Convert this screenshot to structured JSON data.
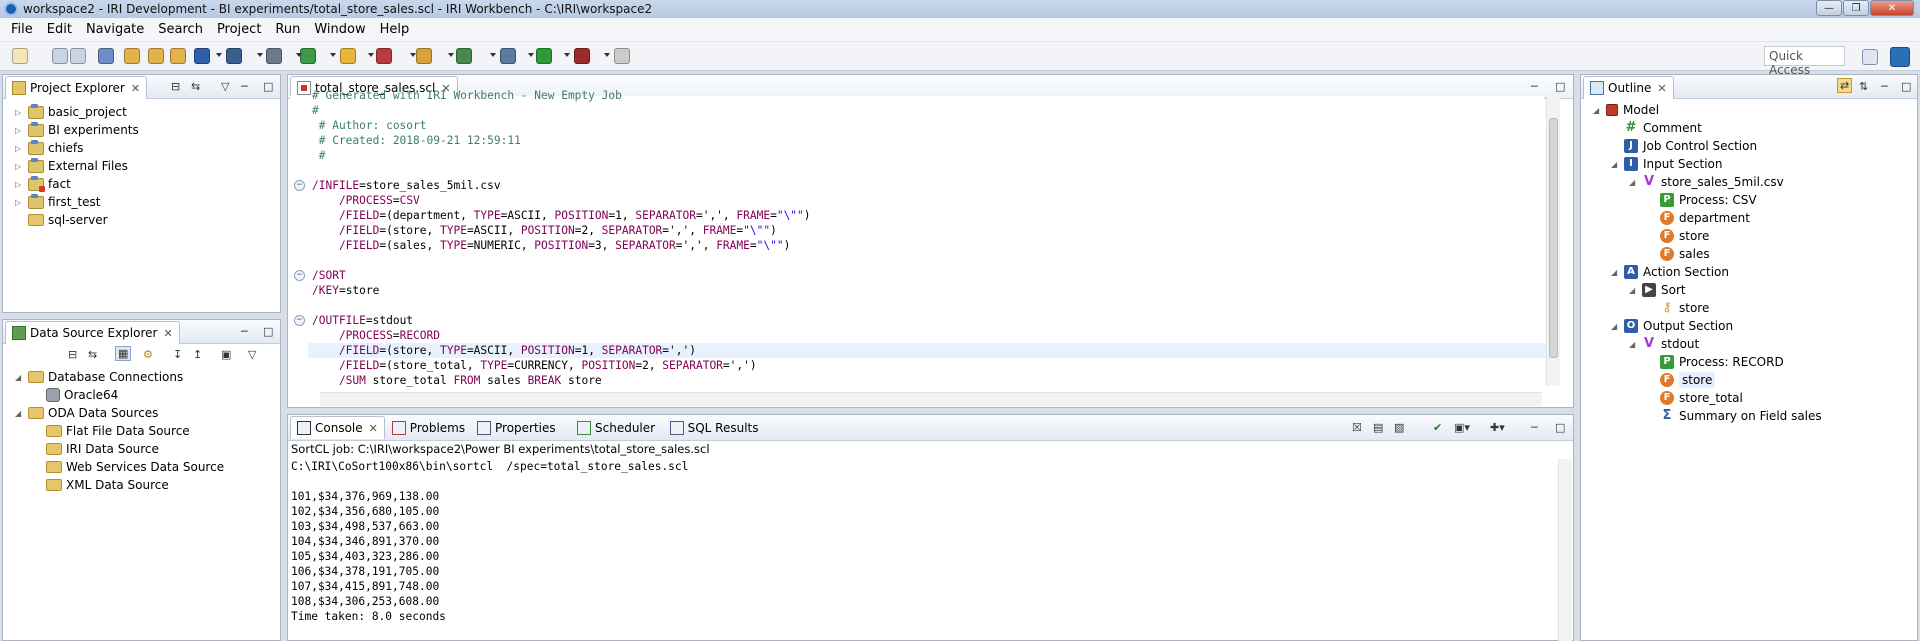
{
  "window": {
    "title": "workspace2 - IRI Development - BI experiments/total_store_sales.scl - IRI Workbench - C:\\IRI\\workspace2"
  },
  "menu": [
    "File",
    "Edit",
    "Navigate",
    "Search",
    "Project",
    "Run",
    "Window",
    "Help"
  ],
  "toolbar": {
    "quick_access": "Quick Access"
  },
  "project_explorer": {
    "tab_label": "Project Explorer",
    "items": [
      {
        "label": "basic_project",
        "kind": "project"
      },
      {
        "label": "BI experiments",
        "kind": "project"
      },
      {
        "label": "chiefs",
        "kind": "project"
      },
      {
        "label": "External Files",
        "kind": "project"
      },
      {
        "label": "fact",
        "kind": "project-error"
      },
      {
        "label": "first_test",
        "kind": "project"
      },
      {
        "label": "sql-server",
        "kind": "folder"
      }
    ]
  },
  "data_source_explorer": {
    "tab_label": "Data Source Explorer",
    "items": [
      {
        "label": "Database Connections",
        "level": 0
      },
      {
        "label": "Oracle64",
        "level": 1
      },
      {
        "label": "ODA Data Sources",
        "level": 0
      },
      {
        "label": "Flat File Data Source",
        "level": 1
      },
      {
        "label": "IRI Data Source",
        "level": 1
      },
      {
        "label": "Web Services Data Source",
        "level": 1
      },
      {
        "label": "XML Data Source",
        "level": 1
      }
    ]
  },
  "editor": {
    "tab_label": "total_store_sales.scl",
    "lines": [
      {
        "parts": [
          {
            "t": "# Generated with IRI Workbench - New Empty Job",
            "c": "cmt"
          }
        ]
      },
      {
        "parts": [
          {
            "t": "#",
            "c": "cmt"
          }
        ]
      },
      {
        "parts": [
          {
            "t": " # Author: cosort",
            "c": "cmt"
          }
        ]
      },
      {
        "parts": [
          {
            "t": " # Created: 2018-09-21 12:59:11",
            "c": "cmt"
          }
        ]
      },
      {
        "parts": [
          {
            "t": " #",
            "c": "cmt"
          }
        ]
      },
      {
        "parts": []
      },
      {
        "parts": [
          {
            "t": "/INFILE",
            "c": "kw"
          },
          {
            "t": "=store_sales_5mil.csv",
            "c": ""
          }
        ],
        "fold": true
      },
      {
        "parts": [
          {
            "t": "    /PROCESS",
            "c": "kw"
          },
          {
            "t": "=",
            "c": ""
          },
          {
            "t": "CSV",
            "c": "kw"
          }
        ]
      },
      {
        "parts": [
          {
            "t": "    /FIELD",
            "c": "kw"
          },
          {
            "t": "=(department, ",
            "c": ""
          },
          {
            "t": "TYPE",
            "c": "kw"
          },
          {
            "t": "=ASCII, ",
            "c": ""
          },
          {
            "t": "POSITION",
            "c": "kw"
          },
          {
            "t": "=1, ",
            "c": ""
          },
          {
            "t": "SEPARATOR",
            "c": "kw"
          },
          {
            "t": "=',', ",
            "c": ""
          },
          {
            "t": "FRAME",
            "c": "kw"
          },
          {
            "t": "=",
            "c": ""
          },
          {
            "t": "\"\\\"\"",
            "c": "str"
          },
          {
            "t": ")",
            "c": ""
          }
        ]
      },
      {
        "parts": [
          {
            "t": "    /FIELD",
            "c": "kw"
          },
          {
            "t": "=(store, ",
            "c": ""
          },
          {
            "t": "TYPE",
            "c": "kw"
          },
          {
            "t": "=ASCII, ",
            "c": ""
          },
          {
            "t": "POSITION",
            "c": "kw"
          },
          {
            "t": "=2, ",
            "c": ""
          },
          {
            "t": "SEPARATOR",
            "c": "kw"
          },
          {
            "t": "=',', ",
            "c": ""
          },
          {
            "t": "FRAME",
            "c": "kw"
          },
          {
            "t": "=",
            "c": ""
          },
          {
            "t": "\"\\\"\"",
            "c": "str"
          },
          {
            "t": ")",
            "c": ""
          }
        ]
      },
      {
        "parts": [
          {
            "t": "    /FIELD",
            "c": "kw"
          },
          {
            "t": "=(sales, ",
            "c": ""
          },
          {
            "t": "TYPE",
            "c": "kw"
          },
          {
            "t": "=NUMERIC, ",
            "c": ""
          },
          {
            "t": "POSITION",
            "c": "kw"
          },
          {
            "t": "=3, ",
            "c": ""
          },
          {
            "t": "SEPARATOR",
            "c": "kw"
          },
          {
            "t": "=',', ",
            "c": ""
          },
          {
            "t": "FRAME",
            "c": "kw"
          },
          {
            "t": "=",
            "c": ""
          },
          {
            "t": "\"\\\"\"",
            "c": "str"
          },
          {
            "t": ")",
            "c": ""
          }
        ]
      },
      {
        "parts": []
      },
      {
        "parts": [
          {
            "t": "/SORT",
            "c": "kw"
          }
        ],
        "fold": true
      },
      {
        "parts": [
          {
            "t": "/KEY",
            "c": "kw"
          },
          {
            "t": "=store",
            "c": ""
          }
        ]
      },
      {
        "parts": []
      },
      {
        "parts": [
          {
            "t": "/OUTFILE",
            "c": "kw"
          },
          {
            "t": "=stdout",
            "c": ""
          }
        ],
        "fold": true
      },
      {
        "parts": [
          {
            "t": "    /PROCESS",
            "c": "kw"
          },
          {
            "t": "=",
            "c": ""
          },
          {
            "t": "RECORD",
            "c": "kw"
          }
        ]
      },
      {
        "parts": [
          {
            "t": "    /FIELD",
            "c": "kw"
          },
          {
            "t": "=(store, ",
            "c": ""
          },
          {
            "t": "TYPE",
            "c": "kw"
          },
          {
            "t": "=ASCII, ",
            "c": ""
          },
          {
            "t": "POSITION",
            "c": "kw"
          },
          {
            "t": "=1, ",
            "c": ""
          },
          {
            "t": "SEPARATOR",
            "c": "kw"
          },
          {
            "t": "=',')",
            "c": ""
          }
        ],
        "highlight": true
      },
      {
        "parts": [
          {
            "t": "    /FIELD",
            "c": "kw"
          },
          {
            "t": "=(store_total, ",
            "c": ""
          },
          {
            "t": "TYPE",
            "c": "kw"
          },
          {
            "t": "=CURRENCY, ",
            "c": ""
          },
          {
            "t": "POSITION",
            "c": "kw"
          },
          {
            "t": "=2, ",
            "c": ""
          },
          {
            "t": "SEPARATOR",
            "c": "kw"
          },
          {
            "t": "=',')",
            "c": ""
          }
        ]
      },
      {
        "parts": [
          {
            "t": "    /SUM",
            "c": "kw"
          },
          {
            "t": " store_total ",
            "c": ""
          },
          {
            "t": "FROM",
            "c": "kw"
          },
          {
            "t": " sales ",
            "c": ""
          },
          {
            "t": "BREAK",
            "c": "kw"
          },
          {
            "t": " store",
            "c": ""
          }
        ]
      }
    ]
  },
  "bottom_tabs": [
    "Console",
    "Problems",
    "Properties",
    "Scheduler",
    "SQL Results"
  ],
  "console": {
    "job_line": "SortCL job: C:\\IRI\\workspace2\\Power BI experiments\\total_store_sales.scl",
    "lines": [
      "C:\\IRI\\CoSort100x86\\bin\\sortcl  /spec=total_store_sales.scl",
      "",
      "101,$34,376,969,138.00",
      "102,$34,356,680,105.00",
      "103,$34,498,537,663.00",
      "104,$34,346,891,370.00",
      "105,$34,403,323,286.00",
      "106,$34,378,191,705.00",
      "107,$34,415,891,748.00",
      "108,$34,306,253,608.00",
      "Time taken: 8.0 seconds"
    ]
  },
  "outline": {
    "tab_label": "Outline",
    "items": [
      {
        "label": "Model",
        "icon": "model",
        "level": 0
      },
      {
        "label": "Comment",
        "icon": "hash",
        "level": 1
      },
      {
        "label": "Job Control Section",
        "icon": "J",
        "level": 1
      },
      {
        "label": "Input Section",
        "icon": "I",
        "level": 1,
        "expanded": true
      },
      {
        "label": "store_sales_5mil.csv",
        "icon": "V",
        "level": 2,
        "expanded": true
      },
      {
        "label": "Process: CSV",
        "icon": "P",
        "level": 3
      },
      {
        "label": "department",
        "icon": "F",
        "level": 3
      },
      {
        "label": "store",
        "icon": "F",
        "level": 3
      },
      {
        "label": "sales",
        "icon": "F",
        "level": 3
      },
      {
        "label": "Action Section",
        "icon": "A",
        "level": 1,
        "expanded": true
      },
      {
        "label": "Sort",
        "icon": "sort",
        "level": 2,
        "expanded": true
      },
      {
        "label": "store",
        "icon": "key",
        "level": 3
      },
      {
        "label": "Output Section",
        "icon": "O",
        "level": 1,
        "expanded": true
      },
      {
        "label": "stdout",
        "icon": "V",
        "level": 2,
        "expanded": true
      },
      {
        "label": "Process: RECORD",
        "icon": "P",
        "level": 3
      },
      {
        "label": "store",
        "icon": "F",
        "level": 3,
        "selected": true
      },
      {
        "label": "store_total",
        "icon": "F",
        "level": 3
      },
      {
        "label": "Summary on Field sales",
        "icon": "sigma",
        "level": 3
      }
    ]
  },
  "colors": {
    "keyword": "#7f0055",
    "comment": "#3f7f5f",
    "string": "#2a00ff"
  }
}
